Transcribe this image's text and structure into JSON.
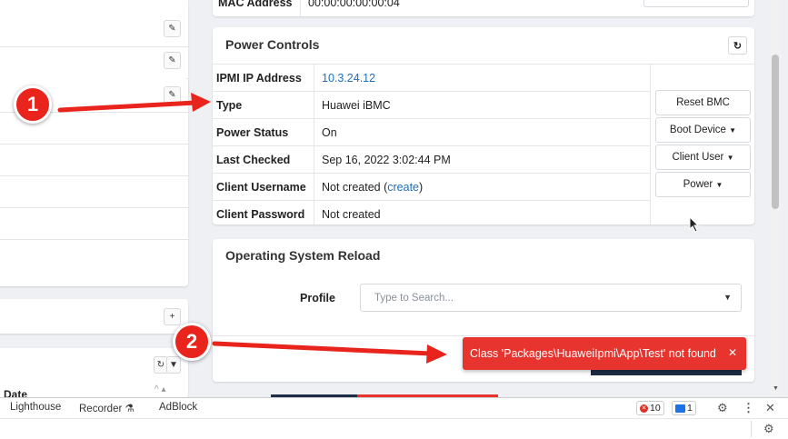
{
  "top_strip": {
    "mac_label": "MAC Address",
    "mac_value": "00:00:00:00:00:04"
  },
  "power_controls": {
    "title": "Power Controls",
    "rows": [
      {
        "key": "IPMI IP Address",
        "value": "10.3.24.12"
      },
      {
        "key": "Type",
        "value": "Huawei iBMC"
      },
      {
        "key": "Power Status",
        "value": "On"
      },
      {
        "key": "Last Checked",
        "value": "Sep 16, 2022 3:02:44 PM"
      },
      {
        "key": "Client Username",
        "value_prefix": "Not created (",
        "link": "create",
        "value_suffix": ")"
      },
      {
        "key": "Client Password",
        "value": "Not created"
      }
    ],
    "buttons": {
      "reset_bmc": "Reset BMC",
      "boot_device": "Boot Device",
      "client_user": "Client User",
      "power": "Power"
    }
  },
  "os_reload": {
    "title": "Operating System Reload",
    "profile_label": "Profile",
    "profile_placeholder": "Type to Search..."
  },
  "toast": {
    "message": "Class 'Packages\\HuaweiIpmi\\App\\Test' not found"
  },
  "left": {
    "date_label": "Date"
  },
  "devtools": {
    "tabs": [
      "Lighthouse",
      "Recorder",
      "AdBlock"
    ],
    "error_count": "10",
    "message_count": "1"
  },
  "annotations": {
    "marker_1": "1",
    "marker_2": "2"
  },
  "colors": {
    "link": "#1a6fc0",
    "toast_bg": "#e8342e",
    "annotation_red": "#e8241c"
  },
  "icons": [
    "pencil-icon",
    "refresh-icon",
    "plus-icon",
    "filter-icon",
    "sort-icon",
    "gear-icon",
    "more-vertical-icon",
    "close-icon",
    "flask-icon",
    "chevron-down-icon"
  ]
}
